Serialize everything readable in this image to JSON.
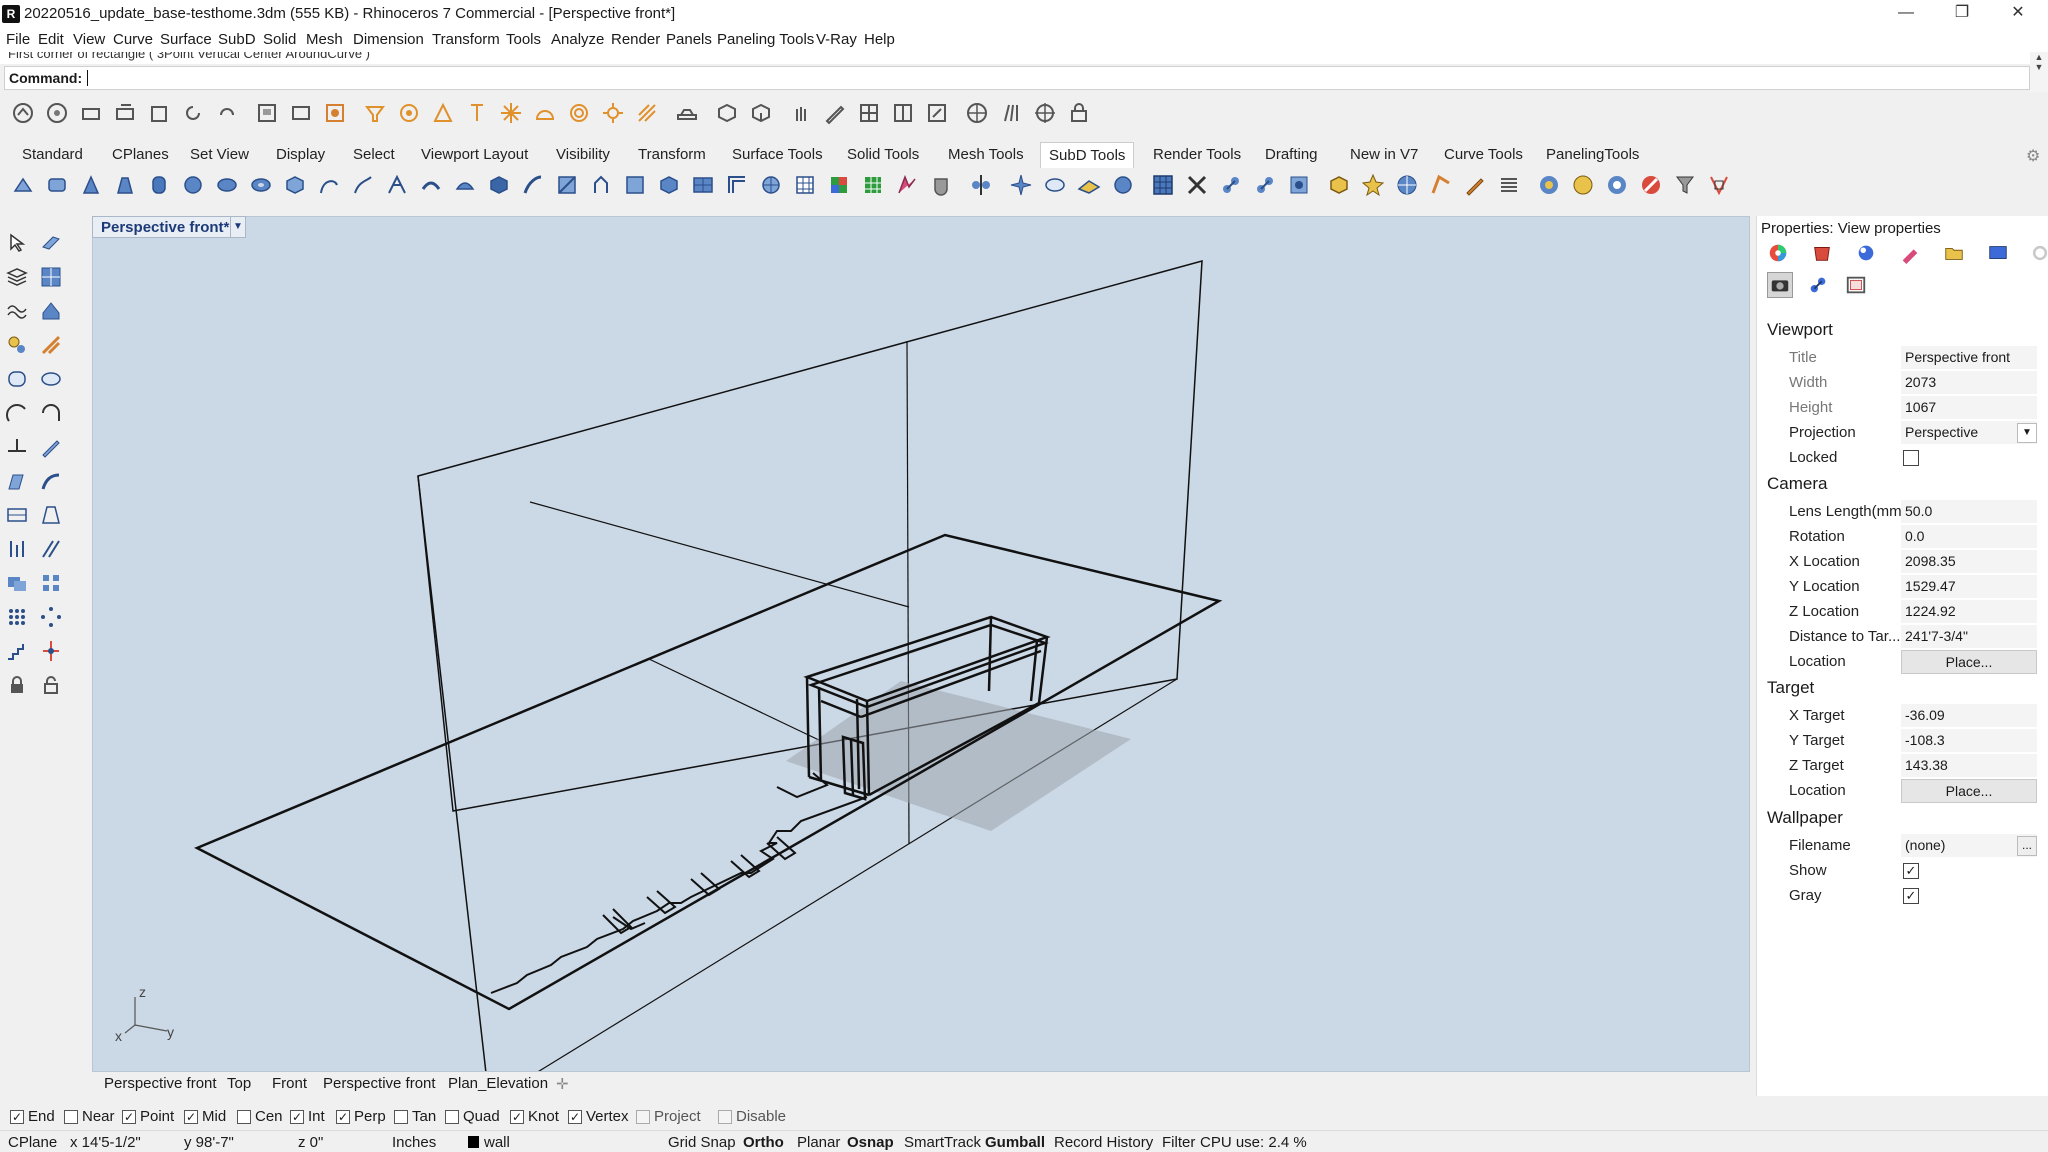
{
  "window": {
    "title": "20220516_update_base-testhome.3dm (555 KB) - Rhinoceros 7 Commercial - [Perspective front*]",
    "minimize": "—",
    "restore": "❐",
    "close": "✕"
  },
  "menu": [
    "File",
    "Edit",
    "View",
    "Curve",
    "Surface",
    "SubD",
    "Solid",
    "Mesh",
    "Dimension",
    "Transform",
    "Tools",
    "Analyze",
    "Render",
    "Panels",
    "Paneling Tools",
    "V-Ray",
    "Help"
  ],
  "command": {
    "history": "First corner of rectangle ( 3Point  Vertical  Center  AroundCurve )",
    "label": "Command:",
    "value": ""
  },
  "toolbar_tabs": [
    "Standard",
    "CPlanes",
    "Set View",
    "Display",
    "Select",
    "Viewport Layout",
    "Visibility",
    "Transform",
    "Surface Tools",
    "Solid Tools",
    "Mesh Tools",
    "SubD Tools",
    "Render Tools",
    "Drafting",
    "New in V7",
    "Curve Tools",
    "PanelingTools"
  ],
  "active_toolbar_tab": "SubD Tools",
  "viewport": {
    "title": "Perspective front*",
    "axis_x": "x",
    "axis_y": "y",
    "axis_z": "z"
  },
  "viewport_tabs": [
    "Perspective front",
    "Top",
    "Front",
    "Perspective front",
    "Plan_Elevation"
  ],
  "osnaps": [
    {
      "label": "End",
      "checked": true
    },
    {
      "label": "Near",
      "checked": false
    },
    {
      "label": "Point",
      "checked": true
    },
    {
      "label": "Mid",
      "checked": true
    },
    {
      "label": "Cen",
      "checked": false
    },
    {
      "label": "Int",
      "checked": true
    },
    {
      "label": "Perp",
      "checked": true
    },
    {
      "label": "Tan",
      "checked": false
    },
    {
      "label": "Quad",
      "checked": false
    },
    {
      "label": "Knot",
      "checked": true
    },
    {
      "label": "Vertex",
      "checked": true
    },
    {
      "label": "Project",
      "checked": false
    },
    {
      "label": "Disable",
      "checked": false
    }
  ],
  "status": {
    "cplane": "CPlane",
    "x": "x 14'5-1/2\"",
    "y": "y 98'-7\"",
    "z": "z 0\"",
    "units": "Inches",
    "layer": "wall",
    "grid_snap": "Grid Snap",
    "ortho": "Ortho",
    "planar": "Planar",
    "osnap": "Osnap",
    "smarttrack": "SmartTrack",
    "gumball": "Gumball",
    "record_history": "Record History",
    "filter": "Filter",
    "cpu": "CPU use: 2.4 %"
  },
  "properties": {
    "title": "Properties: View properties",
    "viewport_section": "Viewport",
    "title_label": "Title",
    "title_value": "Perspective front",
    "width_label": "Width",
    "width_value": "2073",
    "height_label": "Height",
    "height_value": "1067",
    "projection_label": "Projection",
    "projection_value": "Perspective",
    "locked_label": "Locked",
    "locked": false,
    "camera_section": "Camera",
    "lens_label": "Lens Length(mm)",
    "lens_value": "50.0",
    "rotation_label": "Rotation",
    "rotation_value": "0.0",
    "xloc_label": "X Location",
    "xloc_value": "2098.35",
    "yloc_label": "Y Location",
    "yloc_value": "1529.47",
    "zloc_label": "Z Location",
    "zloc_value": "1224.92",
    "dist_label": "Distance to Tar...",
    "dist_value": "241'7-3/4\"",
    "location_label": "Location",
    "place_label": "Place...",
    "target_section": "Target",
    "xt_label": "X Target",
    "xt_value": "-36.09",
    "yt_label": "Y Target",
    "yt_value": "-108.3",
    "zt_label": "Z Target",
    "zt_value": "143.38",
    "tloc_label": "Location",
    "tplace_label": "Place...",
    "wallpaper_section": "Wallpaper",
    "filename_label": "Filename",
    "filename_value": "(none)",
    "browse_label": "...",
    "show_label": "Show",
    "show": true,
    "gray_label": "Gray",
    "gray": true
  }
}
